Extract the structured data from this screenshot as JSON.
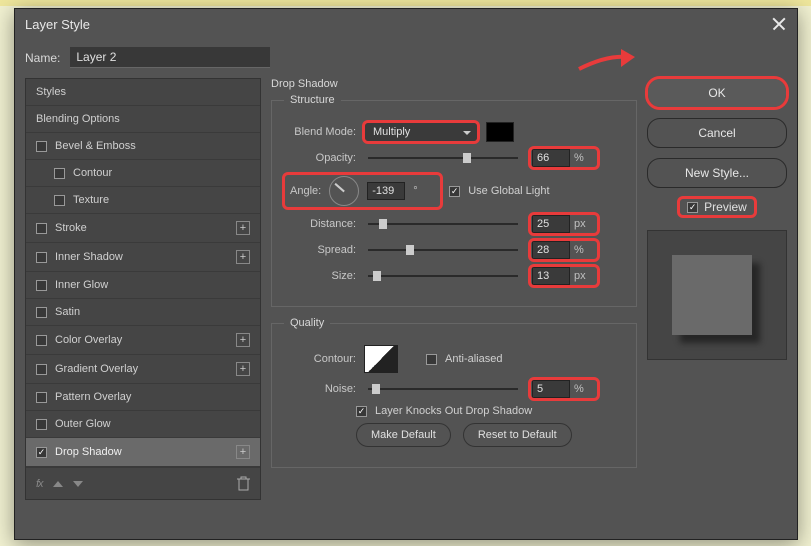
{
  "dialog": {
    "title": "Layer Style"
  },
  "name": {
    "label": "Name:",
    "value": "Layer 2"
  },
  "styles": {
    "header": "Styles",
    "blending": "Blending Options",
    "bevel": "Bevel & Emboss",
    "contour": "Contour",
    "texture": "Texture",
    "stroke": "Stroke",
    "innerShadow": "Inner Shadow",
    "innerGlow": "Inner Glow",
    "satin": "Satin",
    "colorOverlay": "Color Overlay",
    "gradientOverlay": "Gradient Overlay",
    "patternOverlay": "Pattern Overlay",
    "outerGlow": "Outer Glow",
    "dropShadow": "Drop Shadow"
  },
  "footer": {
    "fx": "fx"
  },
  "mid": {
    "heading": "Drop Shadow",
    "structure": "Structure",
    "blendMode": {
      "label": "Blend Mode:",
      "value": "Multiply"
    },
    "opacity": {
      "label": "Opacity:",
      "value": "66",
      "unit": "%"
    },
    "angle": {
      "label": "Angle:",
      "value": "-139",
      "unit": "°",
      "useGlobal": "Use Global Light"
    },
    "distance": {
      "label": "Distance:",
      "value": "25",
      "unit": "px"
    },
    "spread": {
      "label": "Spread:",
      "value": "28",
      "unit": "%"
    },
    "size": {
      "label": "Size:",
      "value": "13",
      "unit": "px"
    },
    "quality": "Quality",
    "contourLabel": "Contour:",
    "antialiased": "Anti-aliased",
    "noise": {
      "label": "Noise:",
      "value": "5",
      "unit": "%"
    },
    "knockout": "Layer Knocks Out Drop Shadow",
    "makeDefault": "Make Default",
    "resetDefault": "Reset to Default"
  },
  "right": {
    "ok": "OK",
    "cancel": "Cancel",
    "newStyle": "New Style...",
    "preview": "Preview"
  }
}
